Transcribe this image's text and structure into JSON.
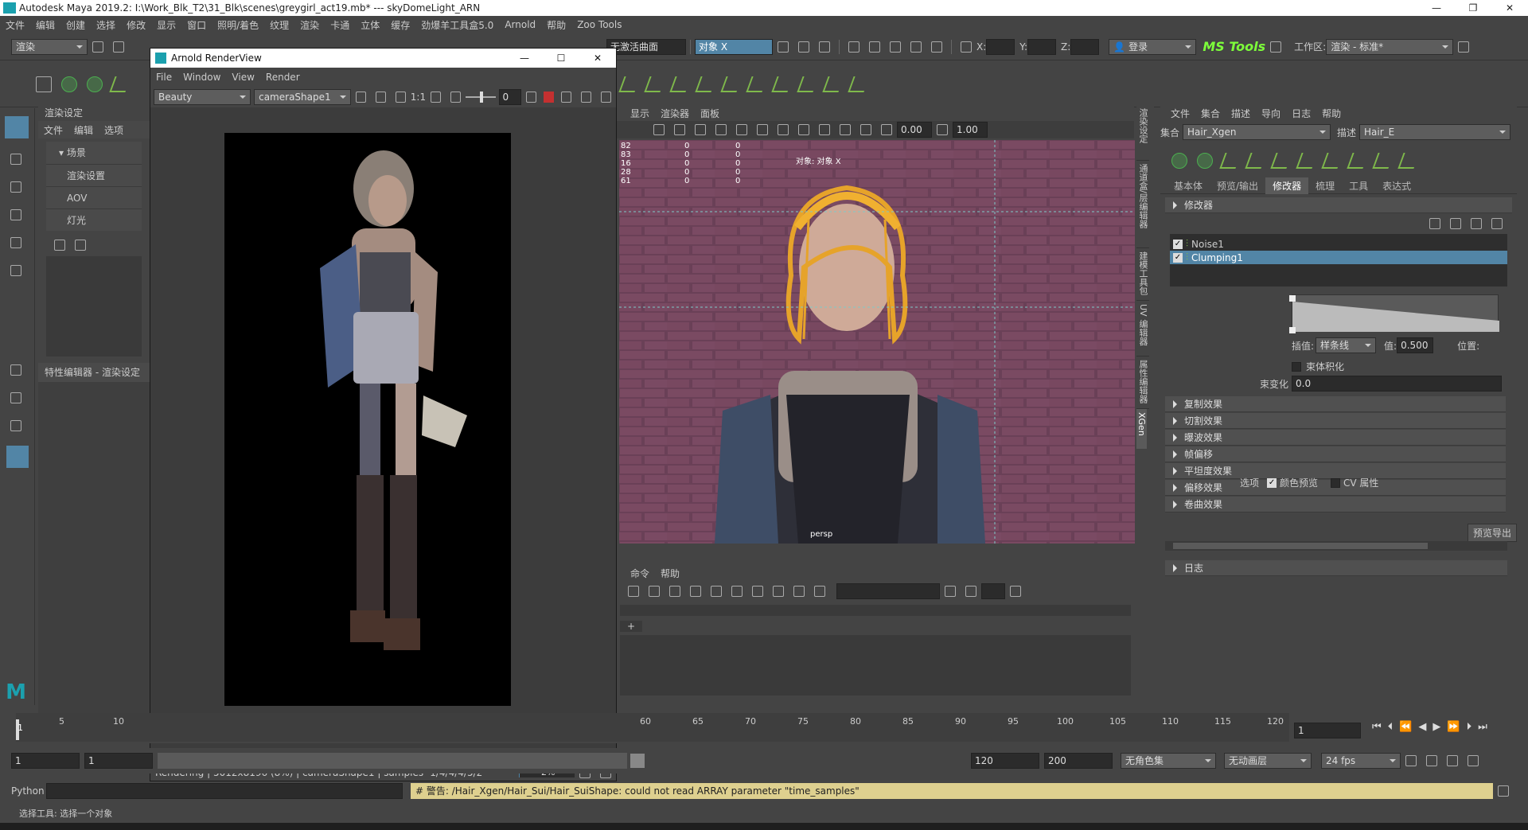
{
  "titlebar": {
    "title": "Autodesk Maya 2019.2: I:\\Work_Blk_T2\\31_Blk\\scenes\\greygirl_act19.mb* --- skyDomeLight_ARN"
  },
  "menubar": {
    "items": [
      "文件",
      "编辑",
      "创建",
      "选择",
      "修改",
      "显示",
      "窗口",
      "照明/着色",
      "纹理",
      "渲染",
      "卡通",
      "立体",
      "缓存",
      "劲爆羊工具盒5.0",
      "Arnold",
      "帮助",
      "Zoo Tools"
    ]
  },
  "status_line": {
    "menuset": "渲染",
    "live_surface": "无激活曲面",
    "select_mode": "对象 X",
    "x_label": "X:",
    "y_label": "Y:",
    "z_label": "Z:",
    "login": "登录",
    "ms_tools": "MS Tools",
    "workspace_label": "工作区:",
    "workspace_value": "渲染 - 标准*"
  },
  "render_settings_panel": {
    "title": "渲染设定",
    "menu": [
      "文件",
      "编辑",
      "选项"
    ],
    "tree": [
      "场景",
      "渲染设置",
      "AOV",
      "灯光"
    ],
    "attr_editor_title": "特性编辑器 - 渲染设定"
  },
  "arnold_renderview": {
    "title": "Arnold RenderView",
    "menu": [
      "File",
      "Window",
      "View",
      "Render"
    ],
    "aov": "Beauty",
    "camera": "cameraShape1",
    "ratio": "1:1",
    "exposure": "0",
    "status": "Rendering | 5012x8196 (8%) | cameraShape1 | samples -1/4/4/4/5/2",
    "progress_text": "2%",
    "progress": 0.02
  },
  "viewport": {
    "menu": [
      "显示",
      "渲染器",
      "面板"
    ],
    "field_a": "0.00",
    "field_b": "1.00",
    "hud_rows": [
      [
        "82",
        "0",
        "0"
      ],
      [
        "83",
        "0",
        "0"
      ],
      [
        "16",
        "0",
        "0"
      ],
      [
        "28",
        "0",
        "0"
      ],
      [
        "61",
        "0",
        "0"
      ]
    ],
    "hud_object": "对象: 对象 X",
    "camera_label": "persp"
  },
  "script_panel": {
    "menu": [
      "命令",
      "帮助"
    ],
    "tab_plus": "+"
  },
  "side_tabs": [
    "渲染设定",
    "通道盒/层编辑器",
    "建模工具包",
    "UV 编辑器",
    "属性编辑器",
    "XGen"
  ],
  "xgen": {
    "menu": [
      "文件",
      "集合",
      "描述",
      "导向",
      "日志",
      "帮助"
    ],
    "collection_label": "集合",
    "collection_value": "Hair_Xgen",
    "description_label": "描述",
    "description_value": "Hair_E",
    "tabs": [
      "基本体",
      "预览/输出",
      "修改器",
      "梳理",
      "工具",
      "表达式"
    ],
    "active_tab": "修改器",
    "modifiers_section": "修改器",
    "modifiers": [
      {
        "name": "Noise1",
        "checked": true,
        "selected": false
      },
      {
        "name": "Clumping1",
        "checked": true,
        "selected": true
      }
    ],
    "interp_label": "插值:",
    "interp_value": "样条线",
    "value_label": "值:",
    "value_value": "0.500",
    "pos_label": "位置:",
    "bundle_label": "束体积化",
    "variation_label": "束变化",
    "variation_value": "0.0",
    "sections": [
      "复制效果",
      "切割效果",
      "曝波效果",
      "帧偏移",
      "平坦度效果",
      "偏移效果",
      "卷曲效果"
    ],
    "options_label": "选项",
    "color_preview": "颜色预览",
    "cv_attr": "CV 属性",
    "preview_btn": "预览导出",
    "log_label": "日志"
  },
  "timeslider": {
    "left_ticks": [
      "1",
      "5",
      "10"
    ],
    "right_ticks": [
      "60",
      "65",
      "70",
      "75",
      "80",
      "85",
      "90",
      "95",
      "100",
      "105",
      "110",
      "115",
      "120"
    ],
    "current_frame": "1"
  },
  "rangeslider": {
    "start": "1",
    "start2": "1",
    "end": "120",
    "end2": "200",
    "char_set": "无角色集",
    "anim_layer": "无动画层",
    "fps": "24 fps"
  },
  "command_line": {
    "label": "Python",
    "warning": "# 警告: /Hair_Xgen/Hair_Sui/Hair_SuiShape: could not read ARRAY parameter \"time_samples\""
  },
  "help_line": {
    "text": "选择工具: 选择一个对象"
  },
  "colors": {
    "maya_bg": "#444444",
    "highlight": "#5285a6",
    "warning_bg": "#ded08f",
    "hair": "#e6a32a",
    "ms_tools_green": "#7dff3a"
  }
}
